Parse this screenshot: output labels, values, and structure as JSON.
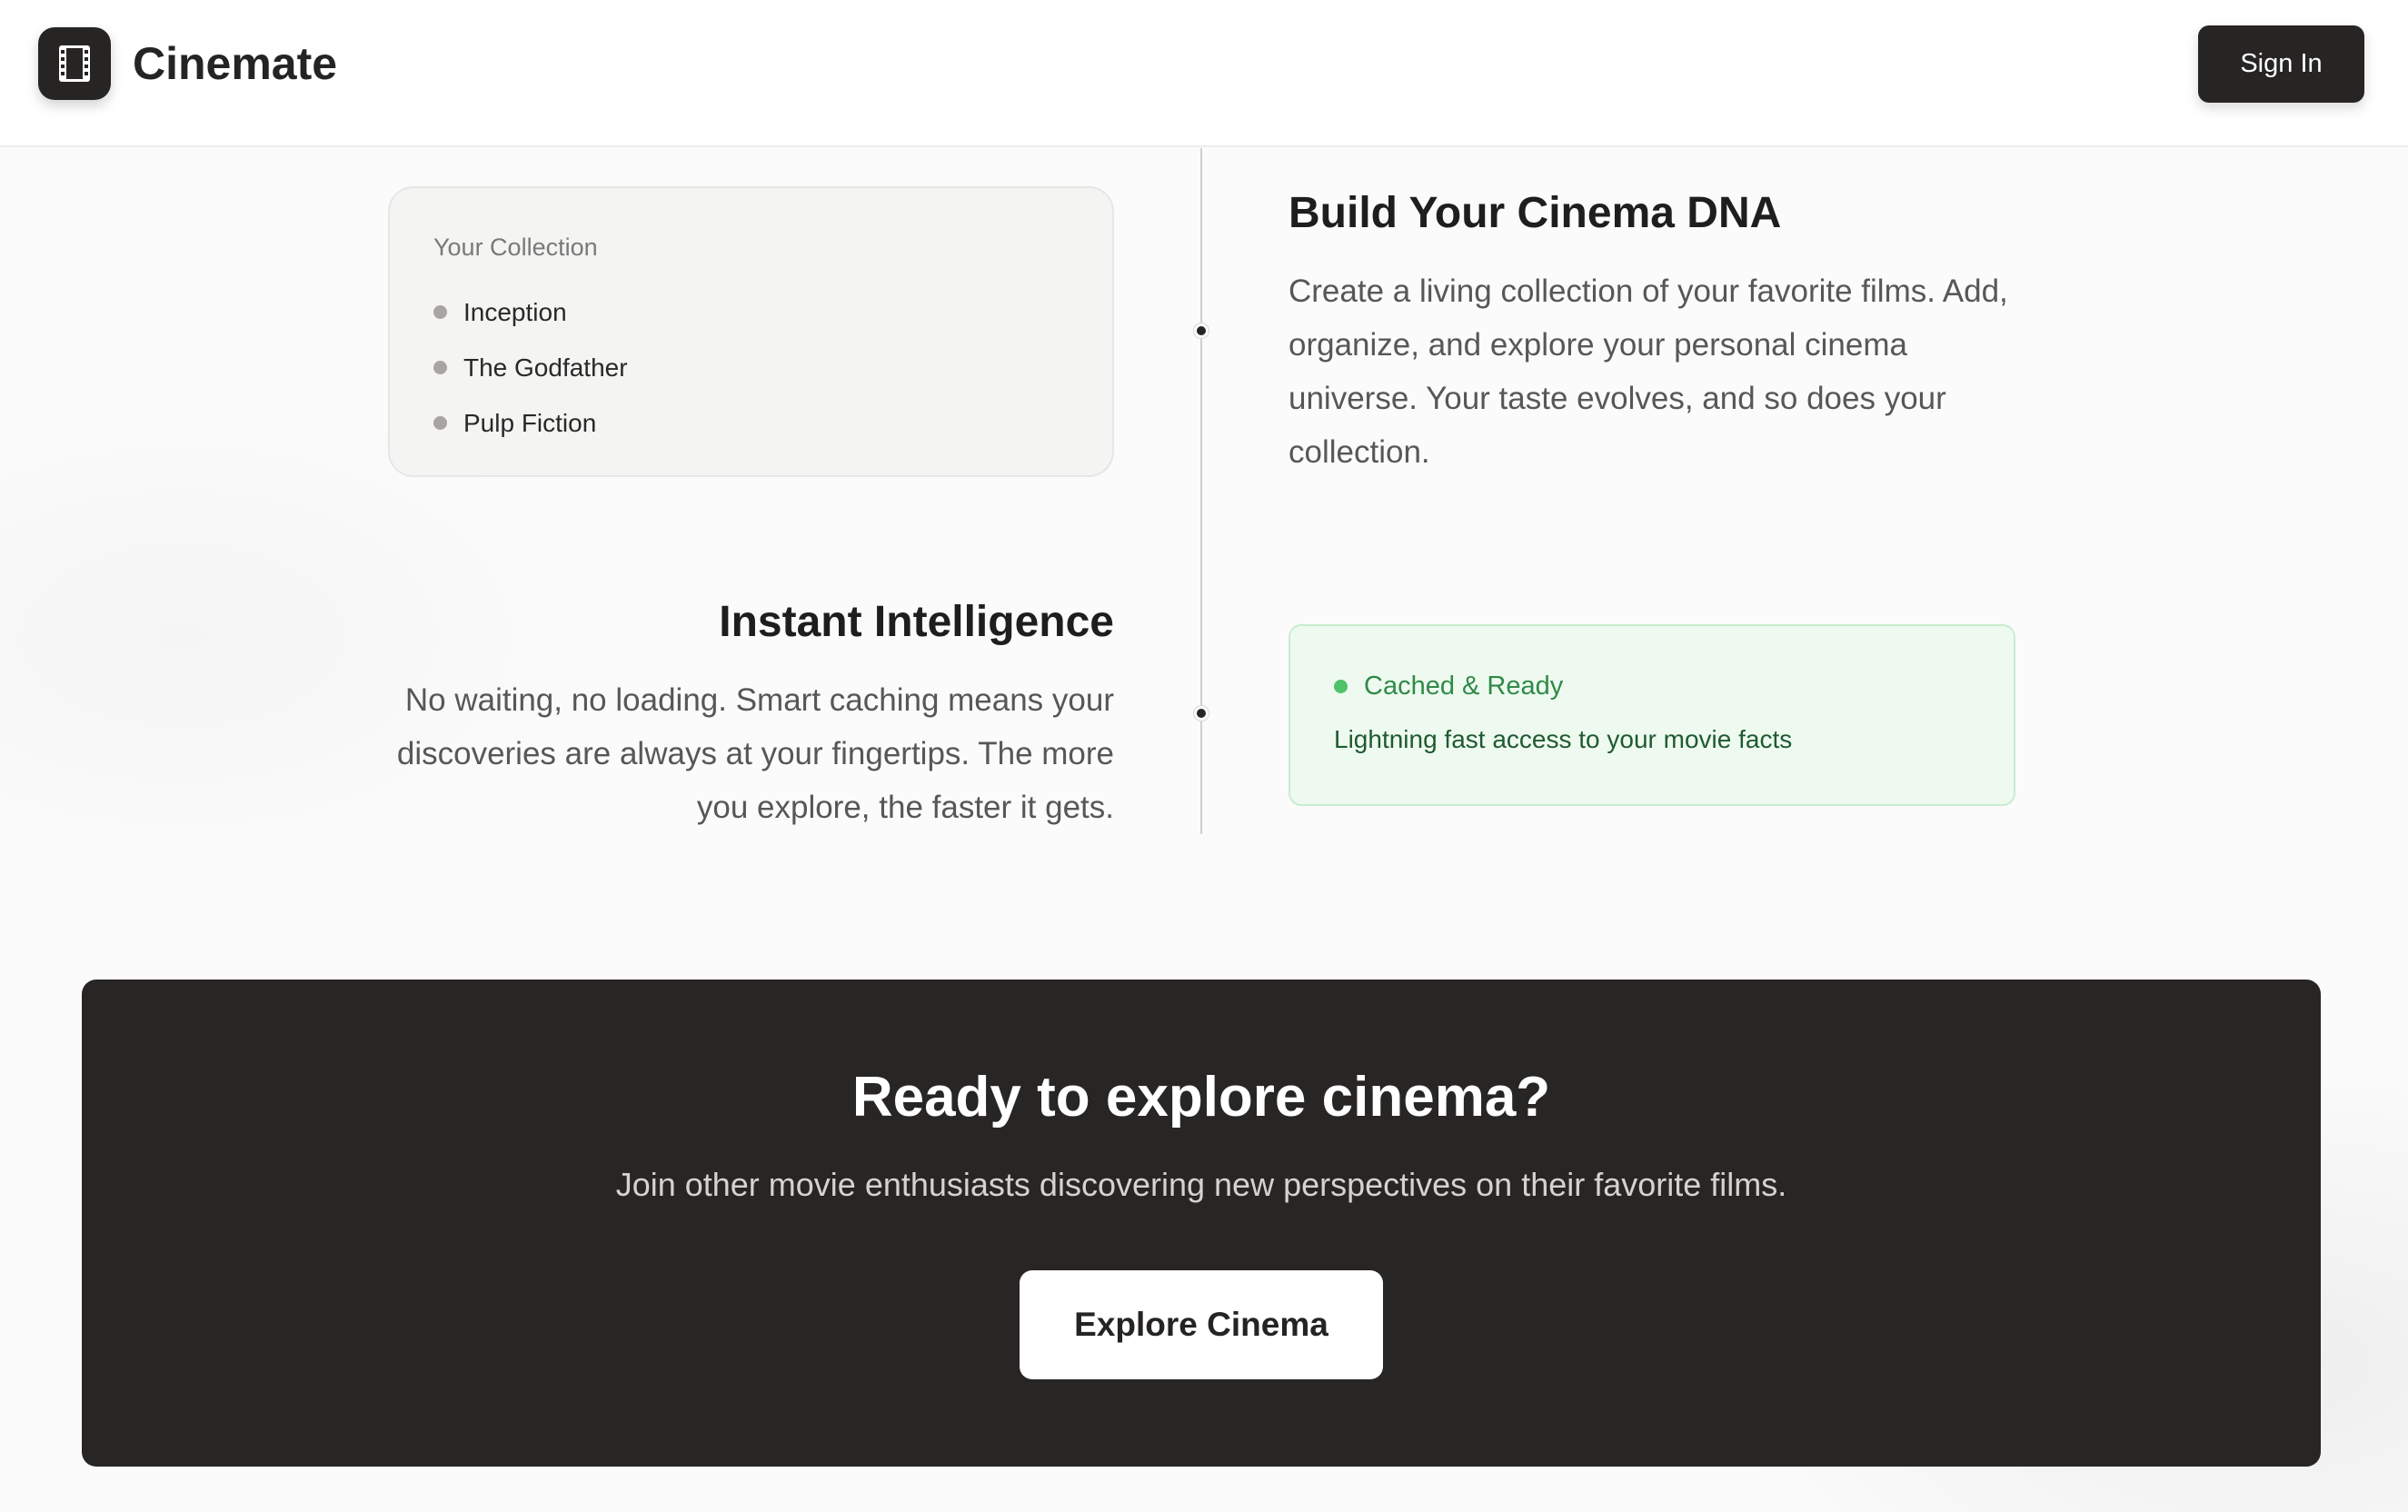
{
  "header": {
    "logo_icon": "film-icon",
    "app_name": "Cinemate",
    "signin_label": "Sign In"
  },
  "collection": {
    "title": "Your Collection",
    "items": [
      "Inception",
      "The Godfather",
      "Pulp Fiction"
    ]
  },
  "features": [
    {
      "title": "Build Your Cinema DNA",
      "description": "Create a living collection of your favorite films. Add, organize, and explore your personal cinema universe. Your taste evolves, and so does your collection."
    },
    {
      "title": "Instant Intelligence",
      "description": "No waiting, no loading. Smart caching means your discoveries are always at your fingertips. The more you explore, the faster it gets."
    }
  ],
  "cache_card": {
    "status": "Cached & Ready",
    "text": "Lightning fast access to your movie facts",
    "status_color": "#4fc26a"
  },
  "cta": {
    "title": "Ready to explore cinema?",
    "subtitle": "Join other movie enthusiasts discovering new perspectives on their favorite films.",
    "button_label": "Explore Cinema"
  },
  "colors": {
    "brand_dark": "#272424",
    "background": "#fbfbfb"
  }
}
